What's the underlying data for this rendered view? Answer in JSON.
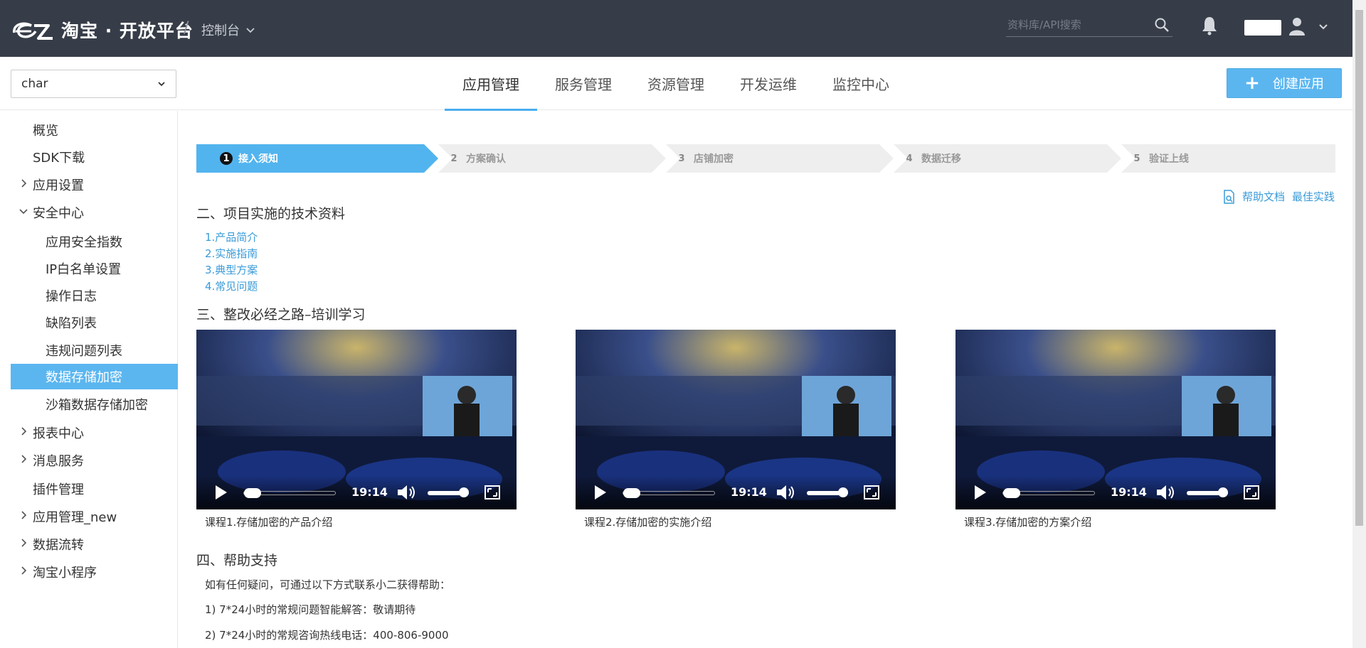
{
  "header": {
    "brand": "淘宝 · 开放平台",
    "separator": "/",
    "console_label": "控制台",
    "search_placeholder": "资料库/API搜索"
  },
  "subbar": {
    "app_select_value": "char",
    "tabs": [
      {
        "label": "应用管理",
        "active": true
      },
      {
        "label": "服务管理",
        "active": false
      },
      {
        "label": "资源管理",
        "active": false
      },
      {
        "label": "开发运维",
        "active": false
      },
      {
        "label": "监控中心",
        "active": false
      }
    ],
    "create_button": "创建应用"
  },
  "sidebar": {
    "items": [
      {
        "label": "概览"
      },
      {
        "label": "SDK下载"
      },
      {
        "label": "应用设置"
      },
      {
        "label": "安全中心"
      },
      {
        "label": "应用安全指数"
      },
      {
        "label": "IP白名单设置"
      },
      {
        "label": "操作日志"
      },
      {
        "label": "缺陷列表"
      },
      {
        "label": "违规问题列表"
      },
      {
        "label": "数据存储加密",
        "active": true
      },
      {
        "label": "沙箱数据存储加密"
      },
      {
        "label": "报表中心"
      },
      {
        "label": "消息服务"
      },
      {
        "label": "插件管理"
      },
      {
        "label": "应用管理_new"
      },
      {
        "label": "数据流转"
      },
      {
        "label": "淘宝小程序"
      }
    ]
  },
  "steps": [
    {
      "num": "1",
      "label": "接入须知",
      "active": true
    },
    {
      "num": "2",
      "label": "方案确认"
    },
    {
      "num": "3",
      "label": "店铺加密"
    },
    {
      "num": "4",
      "label": "数据迁移"
    },
    {
      "num": "5",
      "label": "验证上线"
    }
  ],
  "help_links": {
    "doc": "帮助文档",
    "best_practice": "最佳实践"
  },
  "sections": {
    "tech_title": "二、项目实施的技术资料",
    "tech_links": [
      "1.产品简介",
      "2.实施指南",
      "3.典型方案",
      "4.常见问题"
    ],
    "training_title": "三、整改必经之路–培训学习",
    "videos": [
      {
        "time": "19:14",
        "caption": "课程1.存储加密的产品介绍"
      },
      {
        "time": "19:14",
        "caption": "课程2.存储加密的实施介绍"
      },
      {
        "time": "19:14",
        "caption": "课程3.存储加密的方案介绍"
      }
    ],
    "support_title": "四、帮助支持",
    "support_intro": "如有任何疑问，可通过以下方式联系小二获得帮助：",
    "support_line1": "1) 7*24小时的常规问题智能解答：敬请期待",
    "support_line2": "2) 7*24小时的常规咨询热线电话：400-806-9000"
  },
  "colors": {
    "topbar_bg": "#373d48",
    "accent": "#5bb6f0",
    "link": "#3a9bd9"
  }
}
